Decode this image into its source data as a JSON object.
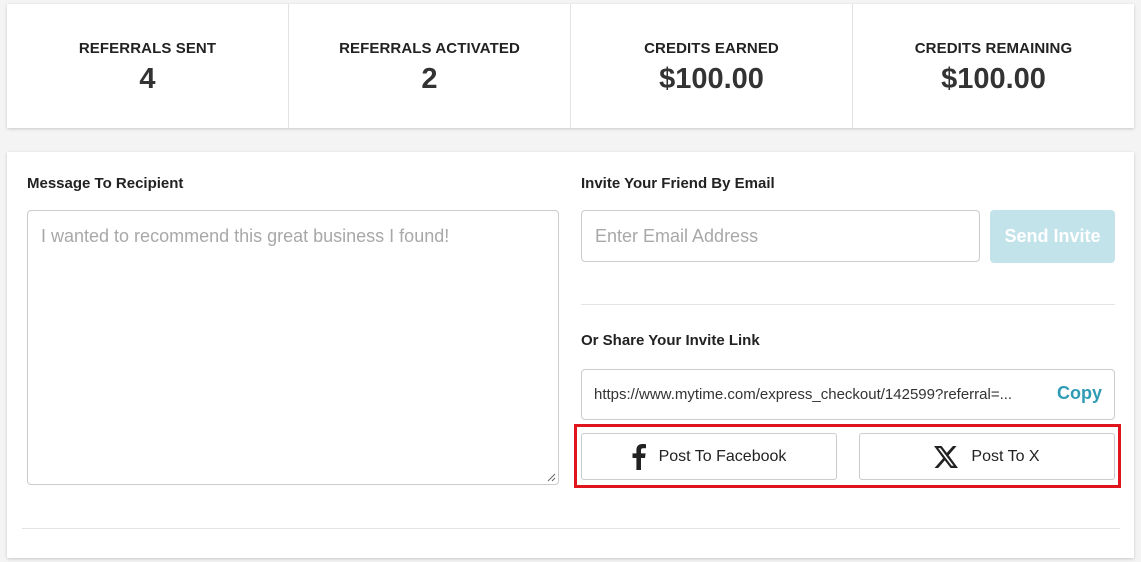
{
  "stats": [
    {
      "label": "REFERRALS SENT",
      "value": "4"
    },
    {
      "label": "REFERRALS ACTIVATED",
      "value": "2"
    },
    {
      "label": "CREDITS EARNED",
      "value": "$100.00"
    },
    {
      "label": "CREDITS REMAINING",
      "value": "$100.00"
    }
  ],
  "message": {
    "label": "Message To Recipient",
    "placeholder": "I wanted to recommend this great business I found!"
  },
  "invite_email": {
    "label": "Invite Your Friend By Email",
    "placeholder": "Enter Email Address",
    "send_label": "Send Invite"
  },
  "share_link": {
    "label": "Or Share Your Invite Link",
    "url": "https://www.mytime.com/express_checkout/142599?referral=...",
    "copy_label": "Copy"
  },
  "social": {
    "facebook_label": "Post To Facebook",
    "x_label": "Post To X",
    "facebook_icon": "facebook-icon",
    "x_icon": "x-logo-icon"
  },
  "colors": {
    "accent": "#2f9bb5",
    "send_disabled": "#c2e3ea",
    "highlight": "#e0141c"
  }
}
